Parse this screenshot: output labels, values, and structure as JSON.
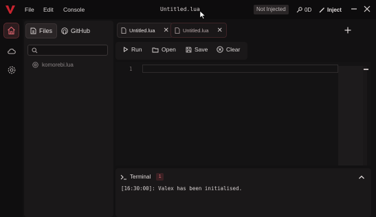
{
  "menu": {
    "file": "File",
    "edit": "Edit",
    "console": "Console"
  },
  "window": {
    "doc_title": "Untitled.lua"
  },
  "status": {
    "injection": "Not Injected",
    "count": "0D",
    "inject_label": "Inject"
  },
  "sidebar": {
    "tabs": [
      {
        "label": "Files",
        "icon": "file-icon",
        "active": true
      },
      {
        "label": "GitHub",
        "icon": "github-icon",
        "active": false
      }
    ],
    "search_placeholder": "",
    "files": [
      {
        "name": "komorebi.lua",
        "icon": "at-icon"
      }
    ]
  },
  "editor_tabs": [
    {
      "label": "Untitled.lua",
      "active": true
    },
    {
      "label": "Untitled.lua",
      "active": false
    }
  ],
  "toolbar": {
    "run": "Run",
    "open": "Open",
    "save": "Save",
    "clear": "Clear"
  },
  "editor": {
    "line_numbers": [
      "1"
    ]
  },
  "terminal": {
    "title": "Terminal",
    "count": "1",
    "lines": [
      "[16:30:00]: Valex has been initialised."
    ]
  },
  "colors": {
    "accent": "#c8242f",
    "background": "#121112",
    "panel": "#1a1819"
  }
}
